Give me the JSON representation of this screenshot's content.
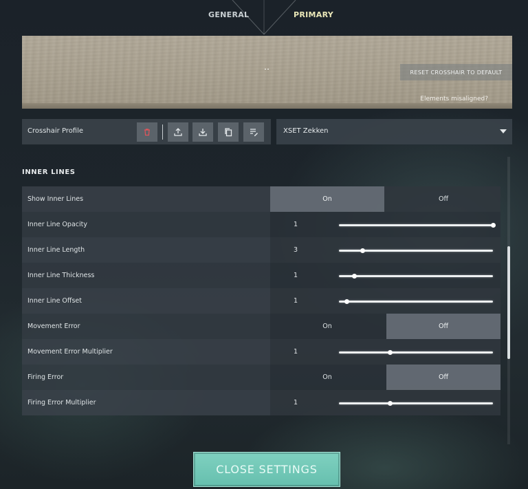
{
  "tabs": {
    "general": "GENERAL",
    "primary": "PRIMARY"
  },
  "preview": {
    "reset_label": "RESET CROSSHAIR TO DEFAULT",
    "misaligned_label": "Elements misaligned?"
  },
  "profile": {
    "label": "Crosshair Profile",
    "selected": "XSET Zekken",
    "icons": [
      "trash-icon",
      "upload-icon",
      "download-icon",
      "copy-icon",
      "rename-icon"
    ]
  },
  "section": {
    "title": "INNER LINES"
  },
  "rows": [
    {
      "label": "Show Inner Lines",
      "type": "toggle",
      "on_label": "On",
      "off_label": "Off",
      "active": "on"
    },
    {
      "label": "Inner Line Opacity",
      "type": "slider",
      "value": "1",
      "position": 1.0
    },
    {
      "label": "Inner Line Length",
      "type": "slider",
      "value": "3",
      "position": 0.15
    },
    {
      "label": "Inner Line Thickness",
      "type": "slider",
      "value": "1",
      "position": 0.1
    },
    {
      "label": "Inner Line Offset",
      "type": "slider",
      "value": "1",
      "position": 0.05
    },
    {
      "label": "Movement Error",
      "type": "toggle",
      "on_label": "On",
      "off_label": "Off",
      "active": "off"
    },
    {
      "label": "Movement Error Multiplier",
      "type": "slider",
      "value": "1",
      "position": 0.33
    },
    {
      "label": "Firing Error",
      "type": "toggle",
      "on_label": "On",
      "off_label": "Off",
      "active": "off"
    },
    {
      "label": "Firing Error Multiplier",
      "type": "slider",
      "value": "1",
      "position": 0.33
    }
  ],
  "close_button": {
    "label": "CLOSE SETTINGS"
  },
  "colors": {
    "accent": "#7fd1c0",
    "primary_tab": "#eae7b8"
  }
}
